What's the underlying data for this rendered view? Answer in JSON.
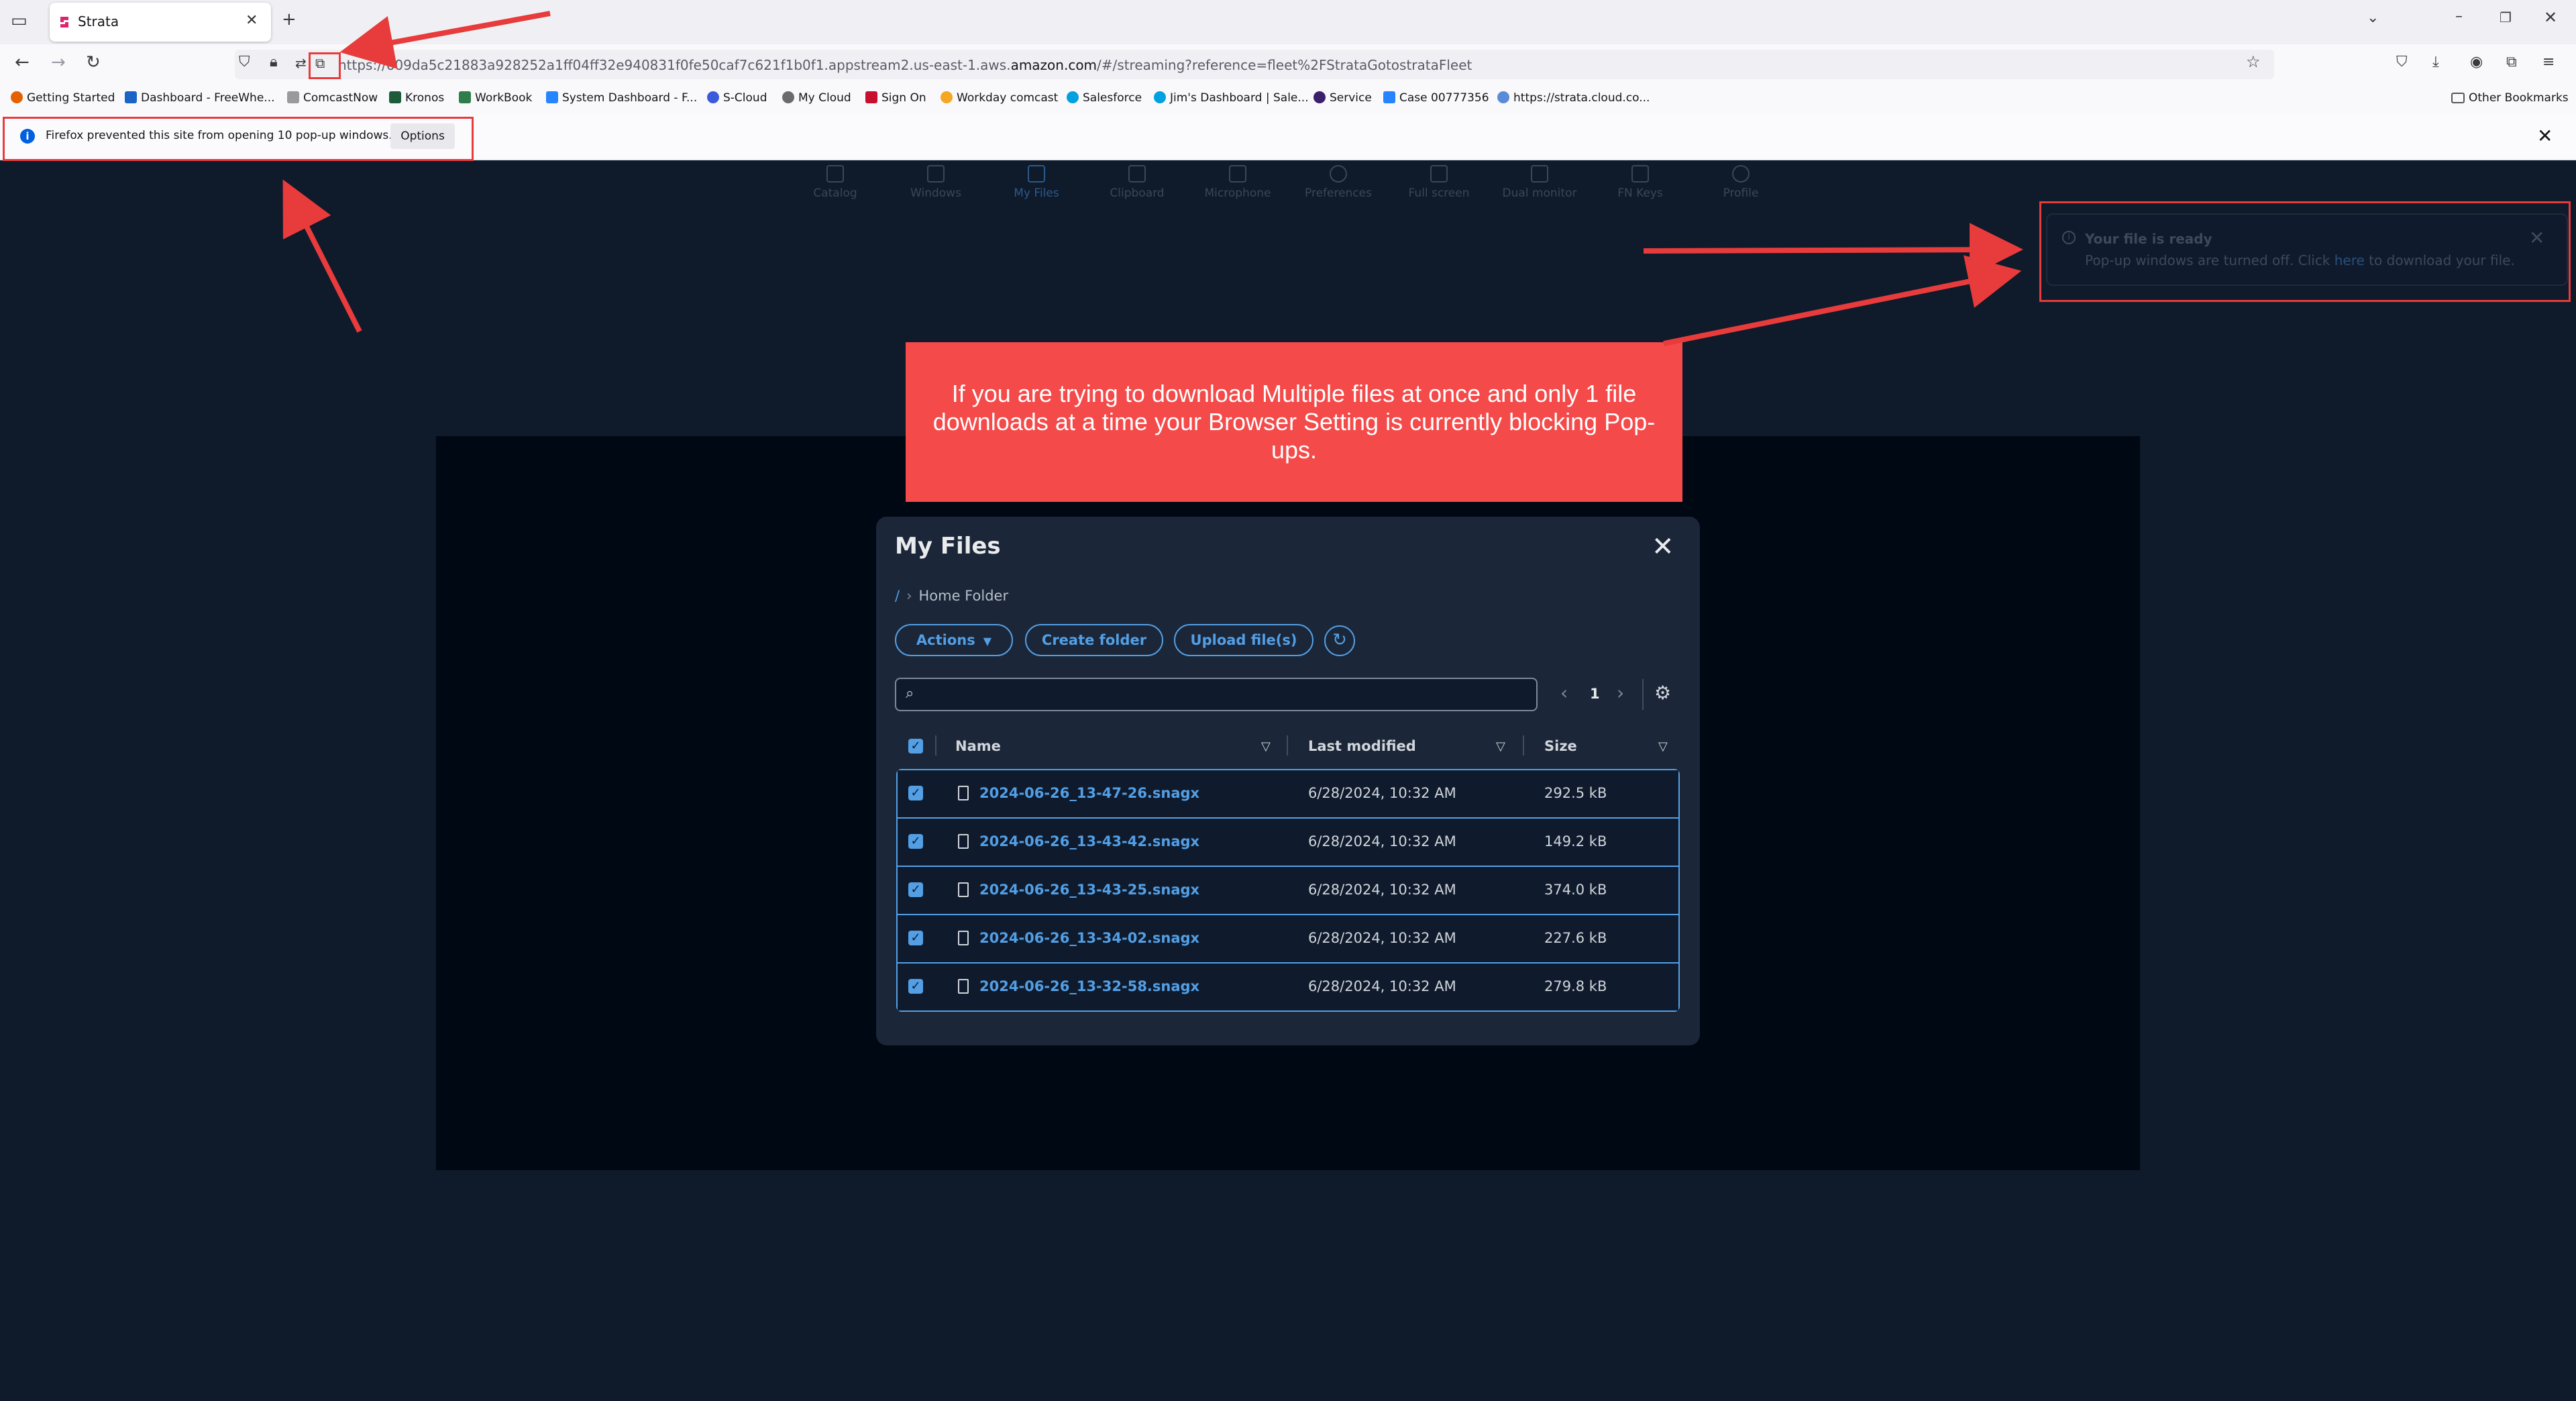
{
  "browser": {
    "tab_title": "Strata",
    "url_prefix": "https://609da5c21883a928252a1ff04ff32e940831f0fe50caf7c621f1b0f1.appstream2.us-east-1.aws.",
    "url_domain": "amazon.com",
    "url_suffix": "/#/streaming?reference=fleet%2FStrataGotostrataFleet",
    "bookmarks": [
      "Getting Started",
      "Dashboard - FreeWhe...",
      "ComcastNow",
      "Kronos",
      "WorkBook",
      "System Dashboard - F...",
      "S-Cloud",
      "My Cloud",
      "Sign On",
      "Workday comcast",
      "Salesforce",
      "Jim's Dashboard | Sale...",
      "Service",
      "Case 00777356",
      "https://strata.cloud.co..."
    ],
    "other_bookmarks": "Other Bookmarks",
    "popup_notice": "Firefox prevented this site from opening 10 pop-up windows.",
    "popup_options": "Options"
  },
  "toolbar": {
    "items": [
      "Catalog",
      "Windows",
      "My Files",
      "Clipboard",
      "Microphone",
      "Preferences",
      "Full screen",
      "Dual monitor",
      "FN Keys",
      "Profile"
    ],
    "active": "My Files"
  },
  "toast": {
    "title": "Your file is ready",
    "text_before": "Pop-up windows are turned off. Click ",
    "link": "here",
    "text_after": " to download your file."
  },
  "callout": {
    "text": "If you are trying to download Multiple files at once and only 1 file downloads at a time your Browser Setting is currently blocking Pop-ups."
  },
  "modal": {
    "title": "My Files",
    "breadcrumb_root": "/",
    "breadcrumb_folder": "Home Folder",
    "actions_label": "Actions",
    "create_folder_label": "Create folder",
    "upload_label": "Upload file(s)",
    "page": "1",
    "columns": {
      "name": "Name",
      "modified": "Last modified",
      "size": "Size"
    },
    "files": [
      {
        "name": "2024-06-26_13-47-26.snagx",
        "modified": "6/28/2024, 10:32 AM",
        "size": "292.5 kB"
      },
      {
        "name": "2024-06-26_13-43-42.snagx",
        "modified": "6/28/2024, 10:32 AM",
        "size": "149.2 kB"
      },
      {
        "name": "2024-06-26_13-43-25.snagx",
        "modified": "6/28/2024, 10:32 AM",
        "size": "374.0 kB"
      },
      {
        "name": "2024-06-26_13-34-02.snagx",
        "modified": "6/28/2024, 10:32 AM",
        "size": "227.6 kB"
      },
      {
        "name": "2024-06-26_13-32-58.snagx",
        "modified": "6/28/2024, 10:32 AM",
        "size": "279.8 kB"
      }
    ]
  },
  "colors": {
    "accent": "#539fe5",
    "annotation": "#e83b3b",
    "callout": "#f44a4a",
    "background": "#0f1a2b"
  }
}
